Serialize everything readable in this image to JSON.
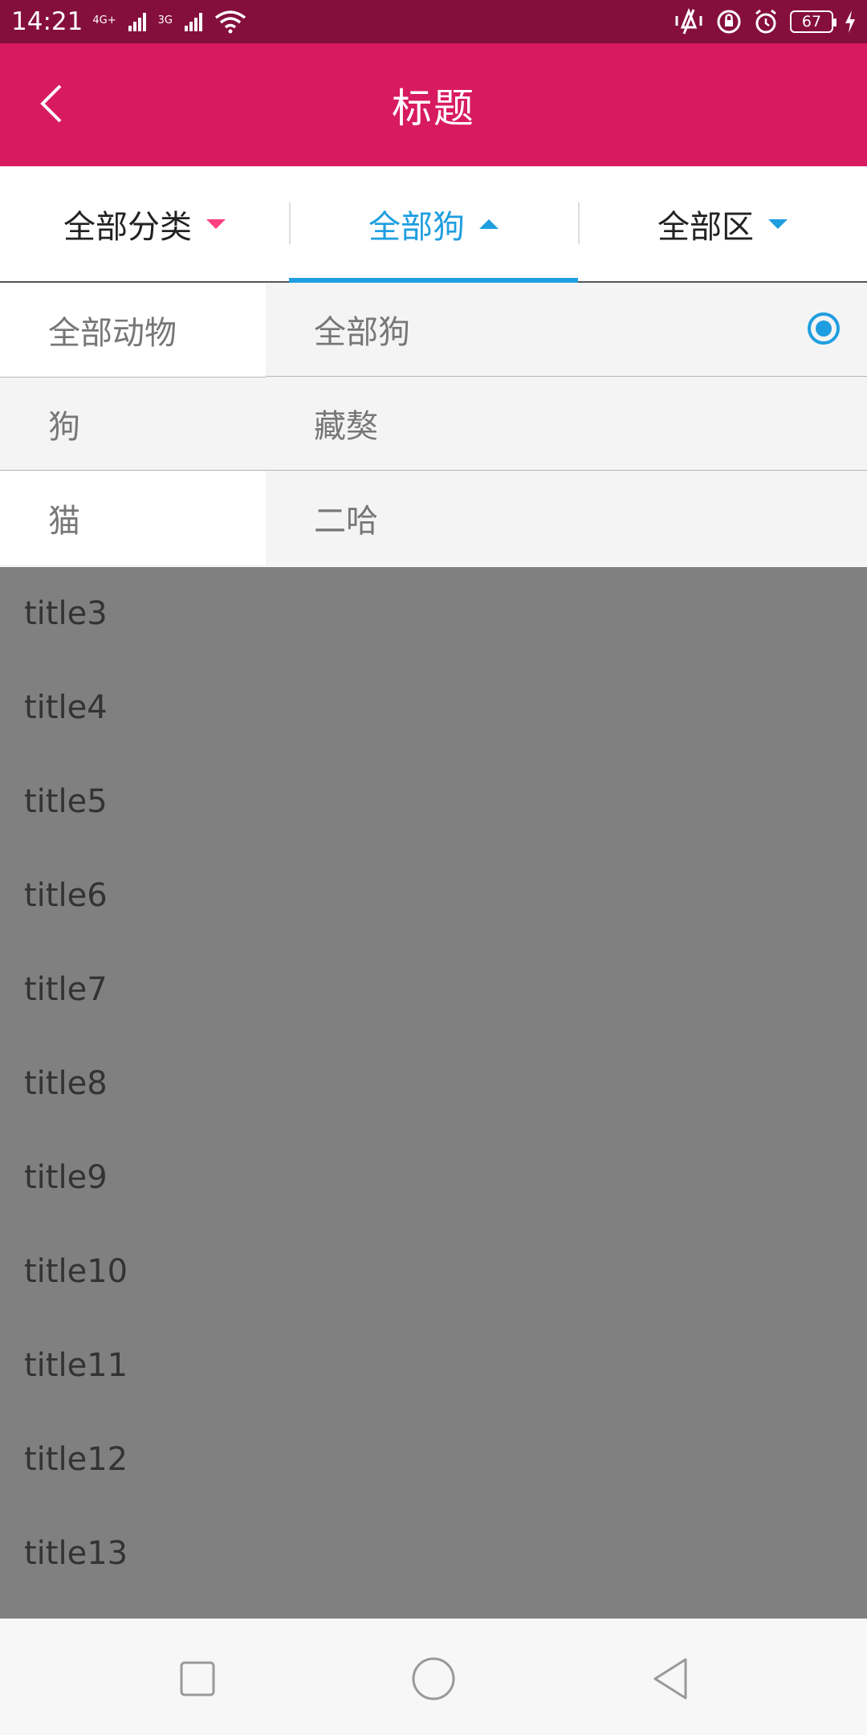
{
  "status_bar": {
    "time": "14:21",
    "net1": "4G+",
    "net2": "3G",
    "battery": "67"
  },
  "app_bar": {
    "title": "标题"
  },
  "filter_tabs": [
    {
      "label": "全部分类"
    },
    {
      "label": "全部狗"
    },
    {
      "label": "全部区"
    }
  ],
  "dropdown": {
    "left": [
      {
        "label": "全部动物"
      },
      {
        "label": "狗"
      },
      {
        "label": "猫"
      }
    ],
    "right": [
      {
        "label": "全部狗"
      },
      {
        "label": "藏獒"
      },
      {
        "label": "二哈"
      }
    ]
  },
  "list": [
    {
      "label": "title3"
    },
    {
      "label": "title4"
    },
    {
      "label": "title5"
    },
    {
      "label": "title6"
    },
    {
      "label": "title7"
    },
    {
      "label": "title8"
    },
    {
      "label": "title9"
    },
    {
      "label": "title10"
    },
    {
      "label": "title11"
    },
    {
      "label": "title12"
    },
    {
      "label": "title13"
    }
  ],
  "colors": {
    "status_bar": "#850f3c",
    "app_bar": "#d81b60",
    "accent_blue": "#1e9ee0",
    "accent_pink": "#ff4081",
    "overlay": "#808080"
  }
}
